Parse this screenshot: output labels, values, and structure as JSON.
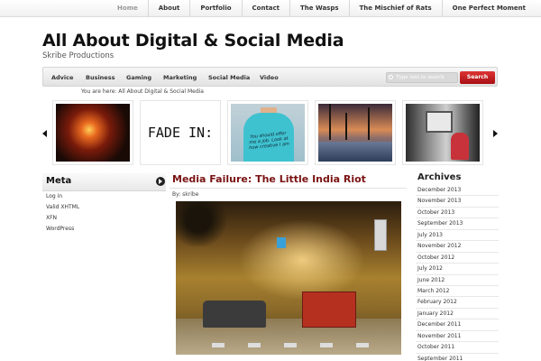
{
  "top_nav": [
    "Home",
    "About",
    "Portfolio",
    "Contact",
    "The Wasps",
    "The Mischief of Rats",
    "One Perfect Moment"
  ],
  "site": {
    "title": "All About Digital & Social Media",
    "tagline": "Skribe Productions"
  },
  "category_nav": [
    "Advice",
    "Business",
    "Gaming",
    "Marketing",
    "Social Media",
    "Video"
  ],
  "search": {
    "placeholder": "Type text to search",
    "button": "Search"
  },
  "breadcrumb": "You are here: All About Digital & Social Media",
  "carousel": {
    "slides": [
      {
        "icon": "fire-photo"
      },
      {
        "text": "FADE IN:"
      },
      {
        "text": "You should offer me a job. Look at how creative I am"
      },
      {
        "icon": "pool-sunset-photo"
      },
      {
        "icon": "train-photo"
      }
    ]
  },
  "meta": {
    "title": "Meta",
    "links": [
      "Log in",
      "Valid XHTML",
      "XFN",
      "WordPress"
    ]
  },
  "post": {
    "title": "Media Failure: The Little India Riot",
    "byline": "By: skribe"
  },
  "archives": {
    "title": "Archives",
    "items": [
      "December 2013",
      "November 2013",
      "October 2013",
      "September 2013",
      "July 2013",
      "November 2012",
      "October 2012",
      "July 2012",
      "June 2012",
      "March 2012",
      "February 2012",
      "January 2012",
      "December 2011",
      "November 2011",
      "October 2011",
      "September 2011"
    ]
  },
  "colors": {
    "accent": "#7a1212",
    "search_button": "#b7141a"
  }
}
